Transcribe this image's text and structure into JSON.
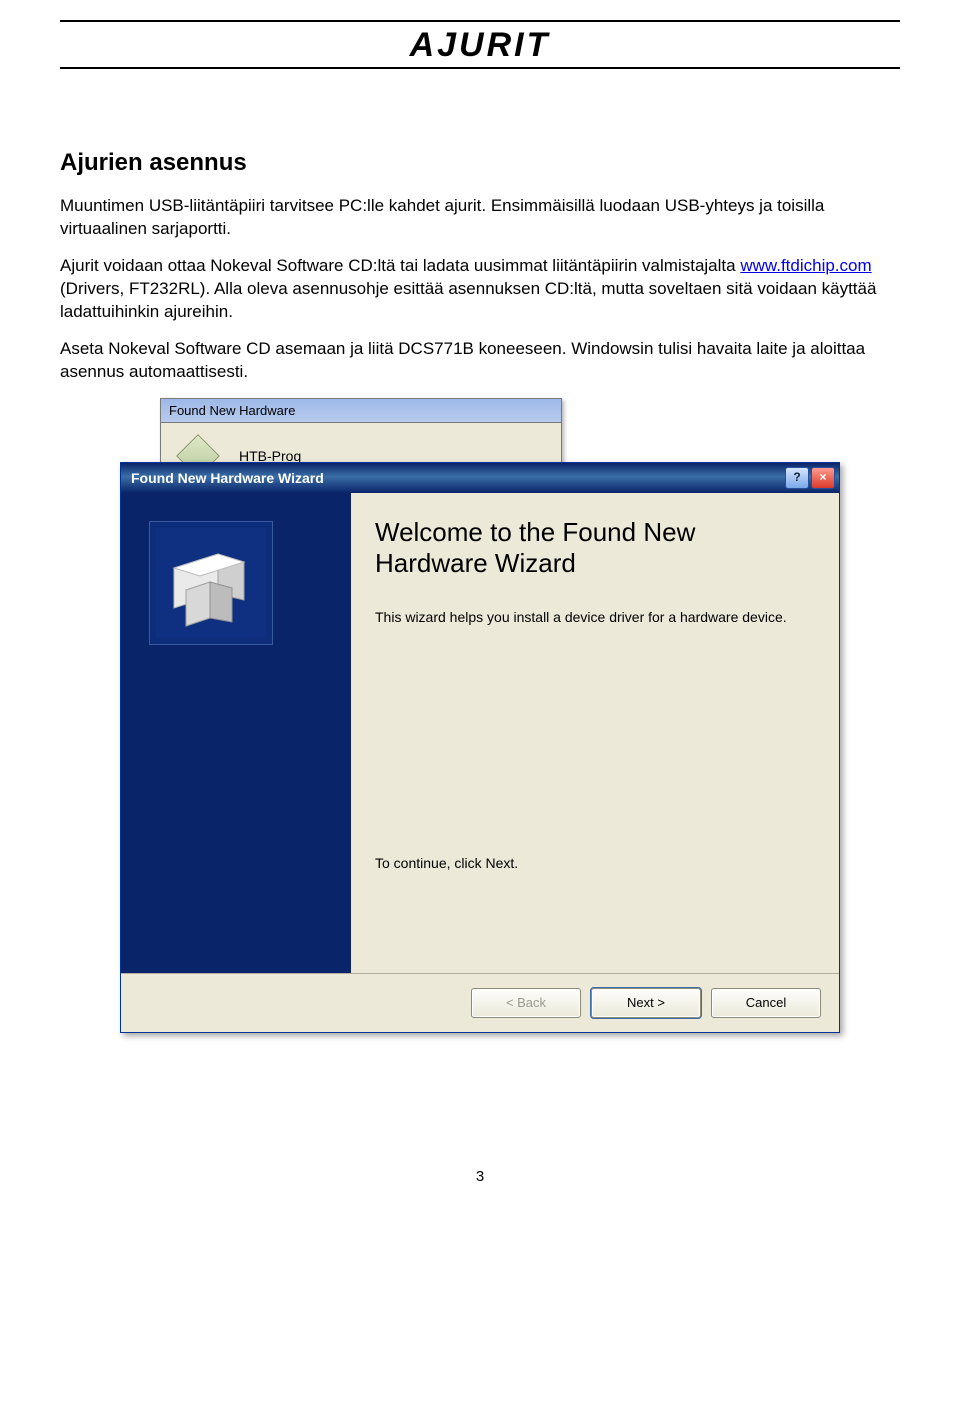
{
  "doc": {
    "title": "AJURIT",
    "section_head": "Ajurien asennus",
    "p1": "Muuntimen USB-liitäntäpiiri tarvitsee PC:lle kahdet ajurit. Ensimmäisillä luodaan USB-yhteys ja toisilla virtuaalinen sarjaportti.",
    "p2_a": "Ajurit voidaan ottaa Nokeval Software CD:ltä tai ladata uusimmat liitäntäpiirin valmistajalta ",
    "p2_link": "www.ftdichip.com",
    "p2_b": " (Drivers, FT232RL). Alla oleva asennusohje esittää asennuksen CD:ltä, mutta soveltaen sitä voidaan käyttää ladattuihinkin ajureihin.",
    "p3": "Aseta Nokeval Software CD asemaan ja liitä DCS771B koneeseen. Windowsin tulisi havaita laite ja aloittaa asennus automaattisesti.",
    "page_num": "3"
  },
  "fnn": {
    "title": "Found New Hardware",
    "device": "HTB-Prog"
  },
  "wizard": {
    "title": "Found New Hardware Wizard",
    "heading": "Welcome to the Found New Hardware Wizard",
    "intro": "This wizard helps you install a device driver for a hardware device.",
    "continue": "To continue, click Next.",
    "buttons": {
      "back": "< Back",
      "next": "Next >",
      "cancel": "Cancel"
    },
    "help_x": "?",
    "close_x": "×"
  }
}
